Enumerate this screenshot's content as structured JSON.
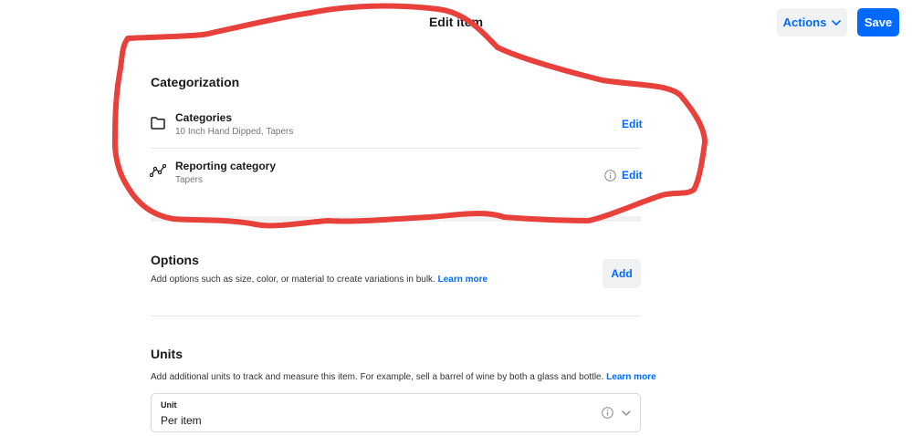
{
  "header": {
    "title": "Edit item",
    "actions_label": "Actions",
    "save_label": "Save"
  },
  "categorization": {
    "title": "Categorization",
    "categories": {
      "label": "Categories",
      "value": "10 Inch Hand Dipped, Tapers",
      "edit_label": "Edit",
      "icon": "folder-icon"
    },
    "reporting": {
      "label": "Reporting category",
      "value": "Tapers",
      "edit_label": "Edit",
      "icon": "reporting-chart-icon"
    }
  },
  "options": {
    "title": "Options",
    "description": "Add options such as size, color, or material to create variations in bulk.",
    "link": "Learn more",
    "add_label": "Add"
  },
  "units": {
    "title": "Units",
    "description": "Add additional units to track and measure this item. For example, sell a barrel of wine by both a glass and bottle.",
    "link": "Learn more",
    "field_label": "Unit",
    "field_value": "Per item"
  },
  "colors": {
    "accent": "#006aff",
    "annotation": "#e8403a"
  }
}
